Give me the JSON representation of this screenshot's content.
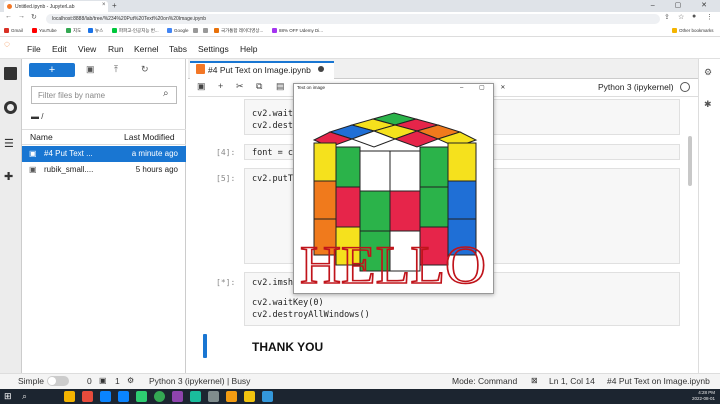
{
  "browser": {
    "tab_title": "Untitled.ipynb - JupyterLab",
    "tab_close": "×",
    "new_tab": "+",
    "url": "localhost:8888/lab/tree/%234%20Put%20Text%20on%20Image.ipynb",
    "bookmarks": [
      "Gmail",
      "YouTube",
      "지도",
      "뉴스",
      "파파고-인공지능 번...",
      "Google",
      "",
      "",
      "국가통합 레이더영상...",
      "88% OFF Udemy Di..."
    ],
    "other_bookmarks": "Other bookmarks",
    "window_controls": "– ▢ ✕"
  },
  "jupyter": {
    "menu": [
      "File",
      "Edit",
      "View",
      "Run",
      "Kernel",
      "Tabs",
      "Settings",
      "Help"
    ],
    "new_button": "+",
    "filter_placeholder": "Filter files by name",
    "breadcrumb": "/",
    "columns": {
      "name": "Name",
      "modified": "Last Modified"
    },
    "files": [
      {
        "name": "#4 Put Text ...",
        "modified": "a minute ago",
        "selected": true
      },
      {
        "name": "rubik_small....",
        "modified": "5 hours ago",
        "selected": false
      }
    ],
    "notebook_tab": "#4 Put Text on Image.ipynb",
    "kernel_name": "Python 3 (ipykernel)"
  },
  "cells": {
    "c1_line1": "cv2.waitK",
    "c1_line2": "cv2.destro",
    "c2_prompt": "[4]:",
    "c2_code": "font = cv",
    "c3_prompt": "[5]:",
    "c3_code": "cv2.putTe",
    "c4_prompt": "[*]:",
    "c4_line1": "cv2.imsho",
    "c4_line2": "cv2.waitKey(0)",
    "c4_line3": "cv2.destroyAllWindows()",
    "markdown": "THANK YOU"
  },
  "popup": {
    "title": "Text on image",
    "controls": "– ▢ ✕",
    "overlay_text": "HELLO"
  },
  "status": {
    "mode_label": "Simple",
    "terminals": "0",
    "kernels": "1",
    "kernel_status": "Python 3 (ipykernel) | Busy",
    "mode": "Mode: Command",
    "position": "Ln 1, Col 14",
    "file": "#4 Put Text on Image.ipynb"
  },
  "taskbar": {
    "time": "4:28 PM",
    "date": "2022-08-01"
  },
  "colors": {
    "accent": "#1976d2",
    "jupyter_orange": "#f37726",
    "hello_red": "#c0141b"
  }
}
